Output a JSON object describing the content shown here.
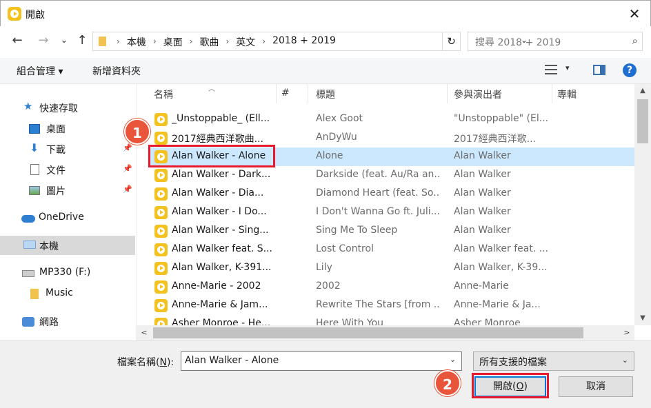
{
  "window": {
    "title": "開啟",
    "close_glyph": "✕"
  },
  "nav": {
    "back": "←",
    "forward": "→",
    "recent": "⌄",
    "up": "↑"
  },
  "address": {
    "crumbs": [
      "本機",
      "桌面",
      "歌曲",
      "英文",
      "2018 + 2019"
    ],
    "separator": "›",
    "dropdown": "⌄",
    "refresh": "↻"
  },
  "search": {
    "placeholder": "搜尋 2018 + 2019",
    "icon": "⌕"
  },
  "toolbar": {
    "organize": "組合管理 ▾",
    "new_folder": "新增資料夾",
    "view_dropdown": "▾",
    "help": "?"
  },
  "sidebar": {
    "items": [
      {
        "label": "快速存取",
        "icon": "★"
      },
      {
        "label": "桌面",
        "pinned": true
      },
      {
        "label": "下載",
        "icon": "⬇",
        "pinned": true
      },
      {
        "label": "文件",
        "pinned": true
      },
      {
        "label": "圖片",
        "pinned": true
      },
      {
        "label": "OneDrive"
      },
      {
        "label": "本機",
        "selected": true
      },
      {
        "label": "MP330 (F:)"
      },
      {
        "label": "Music"
      },
      {
        "label": "網路"
      }
    ],
    "pin_glyph": "📌"
  },
  "columns": {
    "name": "名稱",
    "number": "#",
    "title": "標題",
    "artist": "參與演出者",
    "album": "專輯",
    "sort_glyph": "︿"
  },
  "files": [
    {
      "name": "_Unstoppable_ (Ell...",
      "title": "Alex Goot",
      "artist": "\"Unstoppable\" (El..."
    },
    {
      "name": "2017經典西洋歌曲...",
      "title": "AnDyWu",
      "artist": "2017經典西洋歌..."
    },
    {
      "name": "Alan Walker - Alone",
      "title": "Alone",
      "artist": "Alan Walker"
    },
    {
      "name": "Alan Walker - Dark...",
      "title": "Darkside (feat. Au/Ra an...",
      "artist": "Alan Walker"
    },
    {
      "name": "Alan Walker - Dia...",
      "title": "Diamond Heart (feat. So...",
      "artist": "Alan Walker"
    },
    {
      "name": "Alan Walker - I Do...",
      "title": "I Don't Wanna Go ft. Juli...",
      "artist": "Alan Walker"
    },
    {
      "name": "Alan Walker - Sing...",
      "title": "Sing Me To Sleep",
      "artist": "Alan Walker"
    },
    {
      "name": "Alan Walker feat. S...",
      "title": "Lost Control",
      "artist": "Alan Walker feat. ..."
    },
    {
      "name": "Alan Walker, K-391...",
      "title": "Lily",
      "artist": "Alan Walker, K-39..."
    },
    {
      "name": "Anne-Marie - 2002",
      "title": "2002",
      "artist": "Anne-Marie"
    },
    {
      "name": "Anne-Marie & Jam...",
      "title": "Rewrite The Stars [from ...",
      "artist": "Anne-Marie & Ja..."
    },
    {
      "name": "Asher Monroe - He...",
      "title": "Here With You",
      "artist": "Asher Monroe"
    }
  ],
  "selected_index": 2,
  "scroll": {
    "up": "▲",
    "down": "▼",
    "left": "<",
    "right": ">"
  },
  "footer": {
    "filename_label_prefix": "檔案名稱(",
    "filename_label_key": "N",
    "filename_label_suffix": "):",
    "filename_value": "Alan Walker - Alone",
    "filename_dd": "⌄",
    "filetype": "所有支援的檔案",
    "filetype_dd": "⌄",
    "open_prefix": "開啟(",
    "open_key": "O",
    "open_suffix": ")",
    "cancel": "取消"
  },
  "annotations": {
    "badge1": "1",
    "badge2": "2",
    "highlight_color": "#e8192c",
    "badge_color": "#e8553b"
  }
}
